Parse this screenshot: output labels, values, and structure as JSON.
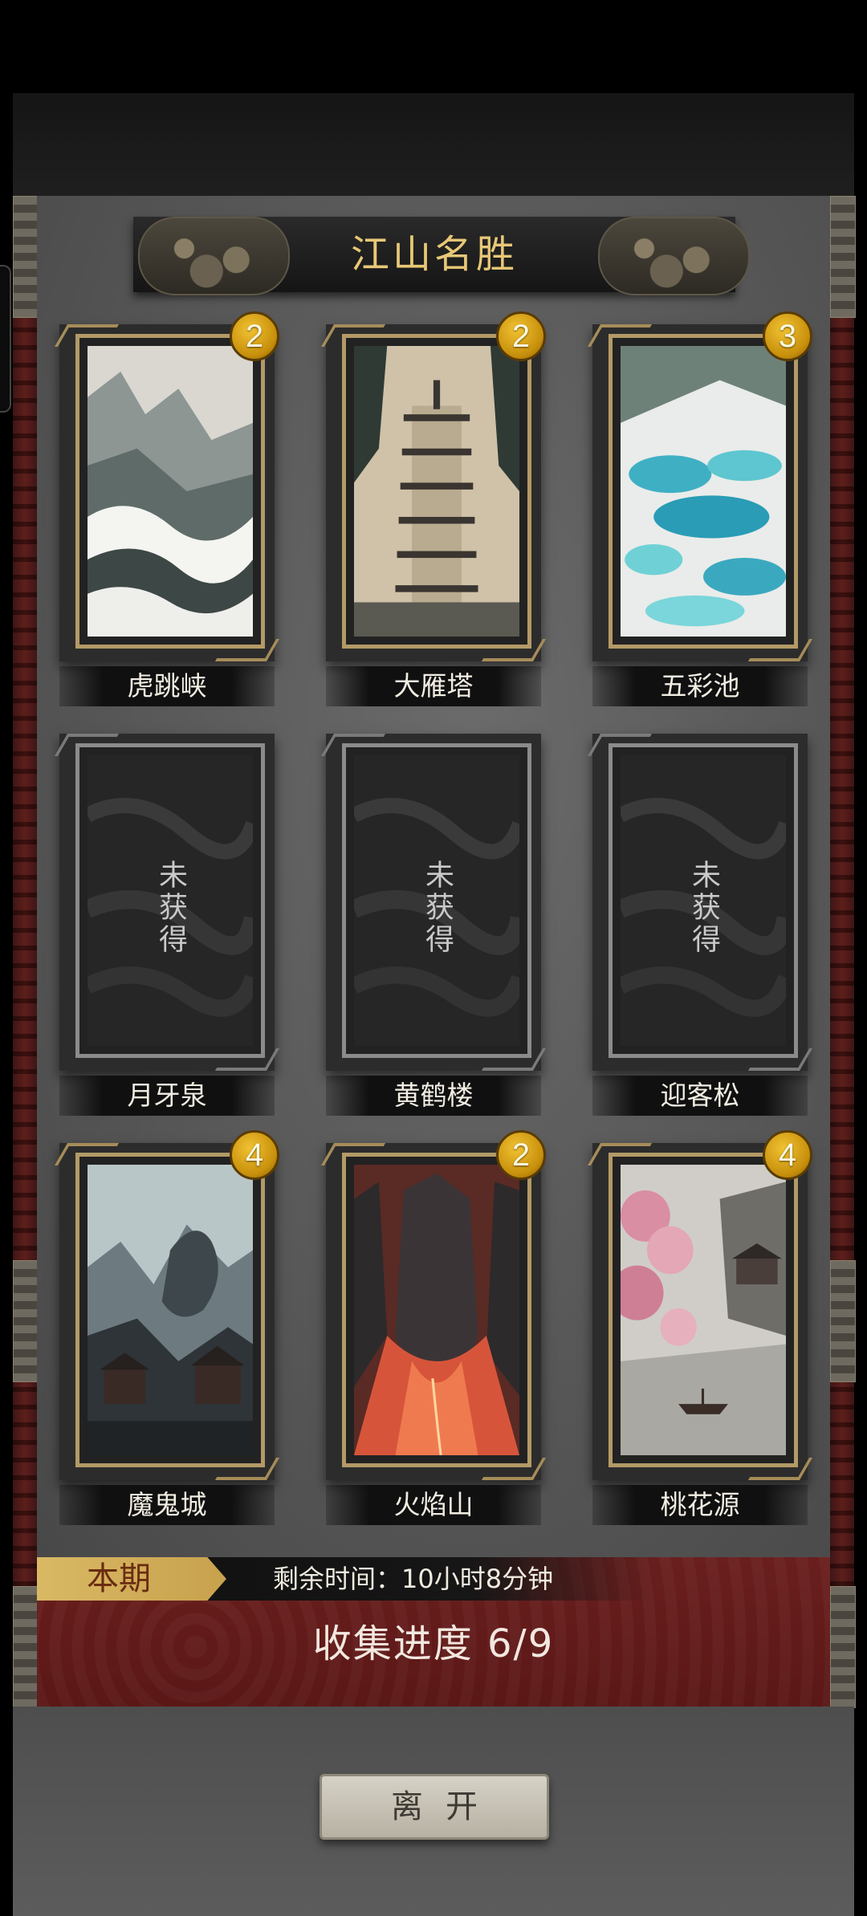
{
  "title": "江山名胜",
  "cards": [
    {
      "name": "虎跳峡",
      "count": "2",
      "art": "gorge-waves",
      "locked": false
    },
    {
      "name": "大雁塔",
      "count": "2",
      "art": "pagoda",
      "locked": false
    },
    {
      "name": "五彩池",
      "count": "3",
      "art": "turquoise-pools",
      "locked": false
    },
    {
      "name": "月牙泉",
      "count": "",
      "art": "locked",
      "locked": true
    },
    {
      "name": "黄鹤楼",
      "count": "",
      "art": "locked",
      "locked": true
    },
    {
      "name": "迎客松",
      "count": "",
      "art": "locked",
      "locked": true
    },
    {
      "name": "魔鬼城",
      "count": "4",
      "art": "demon-city",
      "locked": false
    },
    {
      "name": "火焰山",
      "count": "2",
      "art": "flaming-mountain",
      "locked": false
    },
    {
      "name": "桃花源",
      "count": "4",
      "art": "peach-blossom",
      "locked": false
    }
  ],
  "locked_text": "未获得",
  "season_label": "本期",
  "timer_text": "剩余时间：10小时8分钟",
  "progress_text": "收集进度  6/9",
  "progress": {
    "collected": 6,
    "total": 9
  },
  "leave_label": "离开",
  "colors": {
    "title_gold": "#e8c877",
    "badge_gold": "#e0a820",
    "progress_red": "#5a1716",
    "panel_gray": "#5b5b5b"
  }
}
